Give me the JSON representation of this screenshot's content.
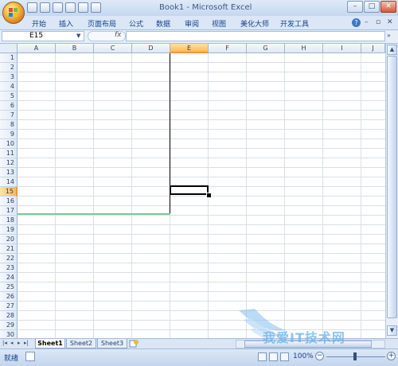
{
  "window": {
    "title": "Book1 - Microsoft Excel",
    "controls": {
      "minimize": "–",
      "restore": "□",
      "close": "✕"
    }
  },
  "quick_access": [
    {
      "icon": "save-icon"
    },
    {
      "icon": "undo-icon"
    },
    {
      "icon": "redo-icon"
    },
    {
      "icon": "new-document-icon"
    },
    {
      "icon": "print-preview-icon"
    },
    {
      "icon": "layout-icon"
    }
  ],
  "ribbon": {
    "tabs": [
      "开始",
      "插入",
      "页面布局",
      "公式",
      "数据",
      "审阅",
      "视图",
      "美化大师",
      "开发工具"
    ],
    "help": "?",
    "minimize": "–",
    "restore": "▫",
    "close": "✕"
  },
  "formula_bar": {
    "name_box": "E15",
    "fx": "fx",
    "formula": "",
    "expand": "»"
  },
  "grid": {
    "columns": [
      "A",
      "B",
      "C",
      "D",
      "E",
      "F",
      "G",
      "H",
      "I",
      "J"
    ],
    "rows": [
      "1",
      "2",
      "3",
      "4",
      "5",
      "6",
      "7",
      "8",
      "9",
      "10",
      "11",
      "12",
      "13",
      "14",
      "15",
      "16",
      "17",
      "18",
      "19",
      "20",
      "21",
      "22",
      "23",
      "24",
      "25",
      "26",
      "27",
      "28",
      "29",
      "30"
    ],
    "selected_column": "E",
    "selected_row": "15",
    "active_cell": "E15"
  },
  "sheet_tabs": {
    "nav": [
      "|◂",
      "◂",
      "▸",
      "▸|"
    ],
    "sheets": [
      "Sheet1",
      "Sheet2",
      "Sheet3"
    ],
    "active": "Sheet1"
  },
  "status_bar": {
    "status": "就绪",
    "zoom": "100%",
    "zoom_minus": "−",
    "zoom_plus": "+"
  },
  "watermark": {
    "text": "我爱IT技术网"
  },
  "colors": {
    "accent": "#f9b95a",
    "border_line": "#000000",
    "bottom_border": "#7fc79b",
    "gridline": "#dadfe6"
  }
}
